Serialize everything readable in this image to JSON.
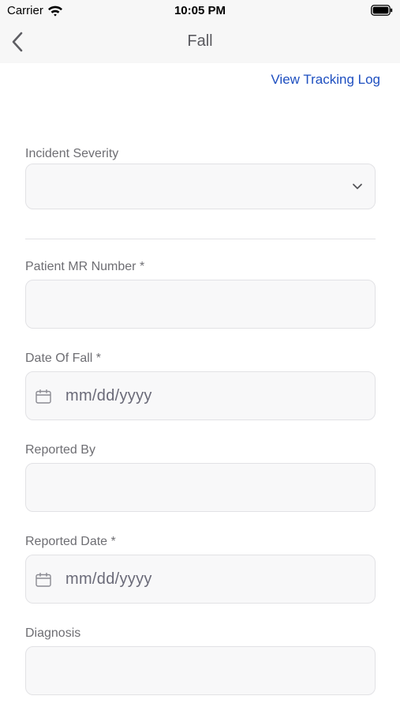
{
  "status_bar": {
    "carrier": "Carrier",
    "time": "10:05 PM",
    "icons": [
      "wifi-icon",
      "battery-icon"
    ]
  },
  "nav": {
    "title": "Fall",
    "back_icon": "chevron-left-icon"
  },
  "links": {
    "view_tracking_log": "View Tracking Log"
  },
  "form": {
    "incident_severity": {
      "label": "Incident Severity",
      "value": "",
      "icon": "chevron-down-icon"
    },
    "patient_mr_number": {
      "label": "Patient MR Number *",
      "value": ""
    },
    "date_of_fall": {
      "label": "Date Of Fall *",
      "placeholder": "mm/dd/yyyy",
      "icon": "calendar-icon"
    },
    "reported_by": {
      "label": "Reported By",
      "value": ""
    },
    "reported_date": {
      "label": "Reported Date *",
      "placeholder": "mm/dd/yyyy",
      "icon": "calendar-icon"
    },
    "diagnosis": {
      "label": "Diagnosis",
      "value": ""
    }
  },
  "colors": {
    "link": "#1e4fc0",
    "label": "#6e6e73",
    "field_bg": "#f8f8f9",
    "field_border": "#e2e2e5",
    "nav_bg": "#f7f7f7"
  }
}
